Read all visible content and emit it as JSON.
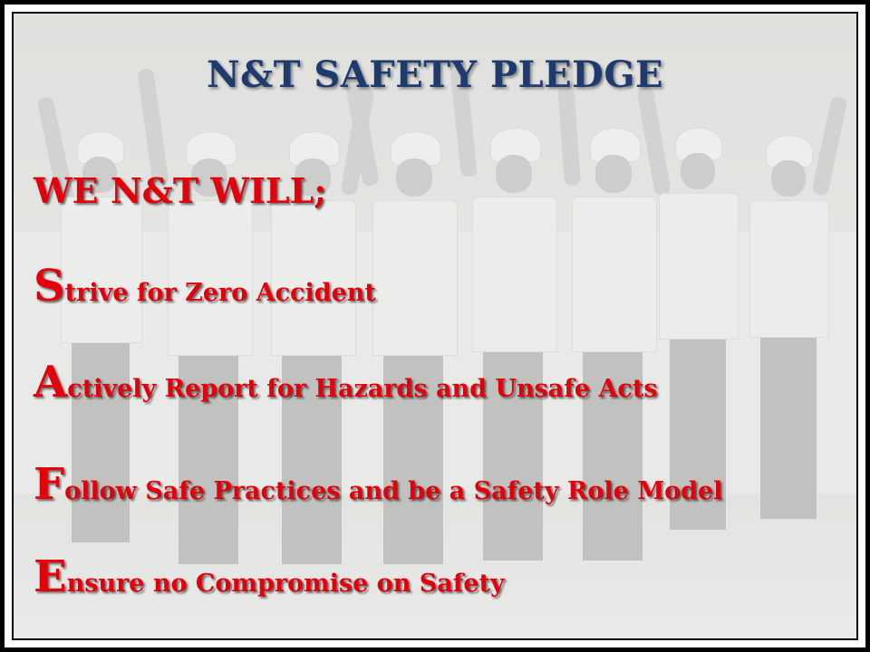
{
  "slide": {
    "title": "N&T SAFETY PLEDGE",
    "heading": "WE N&T WILL;",
    "pledges": [
      {
        "initial": "S",
        "rest": "trive for Zero Accident"
      },
      {
        "initial": "A",
        "rest": "ctively Report for Hazards and Unsafe Acts"
      },
      {
        "initial": "F",
        "rest": "ollow Safe Practices and be a Safety Role Model"
      },
      {
        "initial": "E",
        "rest": "nsure no Compromise on Safety"
      }
    ],
    "background_photo": "group of workers in hard hats and safety vests raising fists",
    "colors": {
      "title": "#1f3a6e",
      "pledge_text": "#e3000b",
      "frame": "#000000"
    }
  }
}
